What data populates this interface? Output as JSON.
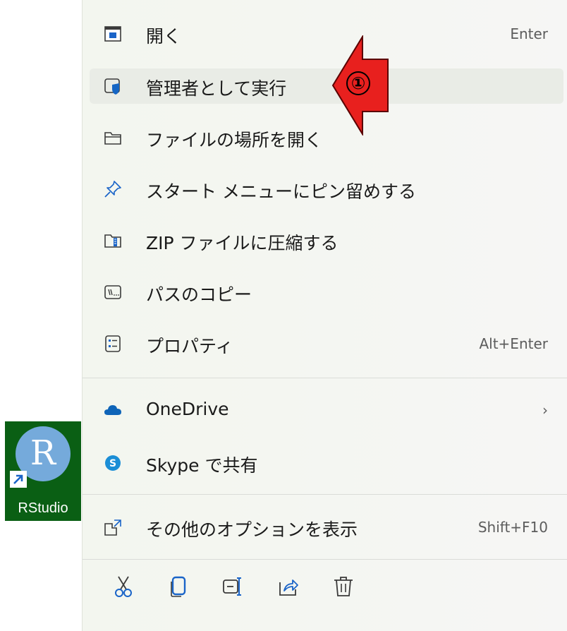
{
  "menu": {
    "items": [
      {
        "label": "開く",
        "accel": "Enter",
        "icon": "open-window-icon"
      },
      {
        "label": "管理者として実行",
        "accel": "",
        "icon": "shield-run-as-admin-icon"
      },
      {
        "label": "ファイルの場所を開く",
        "accel": "",
        "icon": "folder-icon"
      },
      {
        "label": "スタート メニューにピン留めする",
        "accel": "",
        "icon": "pin-icon"
      },
      {
        "label": "ZIP ファイルに圧縮する",
        "accel": "",
        "icon": "zip-folder-icon"
      },
      {
        "label": "パスのコピー",
        "accel": "",
        "icon": "copy-path-icon"
      },
      {
        "label": "プロパティ",
        "accel": "Alt+Enter",
        "icon": "properties-icon"
      },
      {
        "label": "OneDrive",
        "accel": "›",
        "icon": "onedrive-cloud-icon"
      },
      {
        "label": "Skype で共有",
        "accel": "",
        "icon": "skype-icon"
      },
      {
        "label": "その他のオプションを表示",
        "accel": "Shift+F10",
        "icon": "more-options-icon"
      }
    ],
    "toolbar": [
      "cut-icon",
      "copy-icon",
      "rename-icon",
      "share-icon",
      "delete-icon"
    ]
  },
  "annotation": {
    "marker": "①"
  },
  "desktop_icon": {
    "letter": "R",
    "name": "RStudio"
  },
  "colors": {
    "arrow": "#e8201e",
    "onedrive": "#0e64b8",
    "skype": "#1b8ed6",
    "shield": "#1566c4"
  }
}
